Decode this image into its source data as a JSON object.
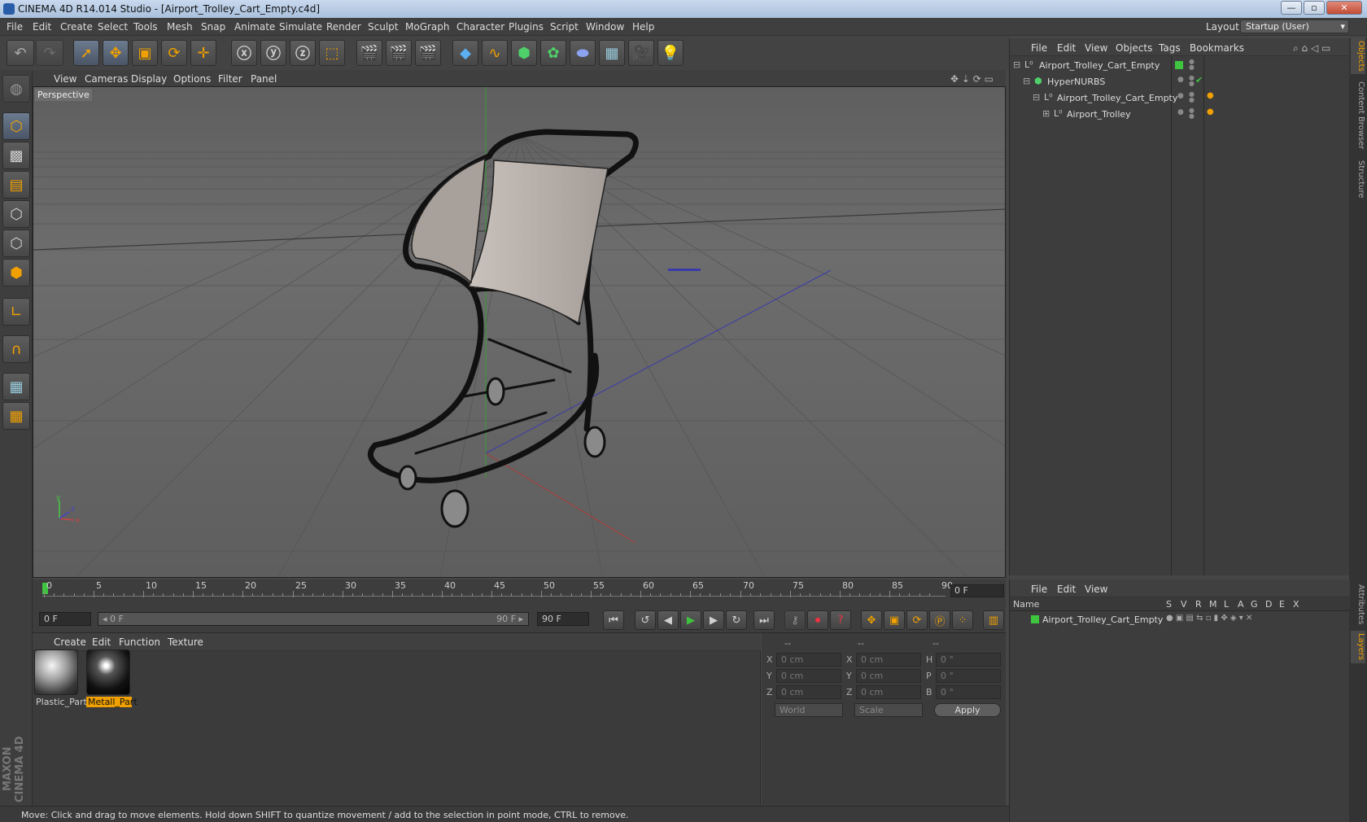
{
  "title_bar": {
    "title": "CINEMA 4D R14.014 Studio - [Airport_Trolley_Cart_Empty.c4d]",
    "min": "—",
    "max": "▫",
    "close": "✕"
  },
  "menu": {
    "items": [
      "File",
      "Edit",
      "Create",
      "Select",
      "Tools",
      "Mesh",
      "Snap",
      "Animate",
      "Simulate",
      "Render",
      "Sculpt",
      "MoGraph",
      "Character",
      "Plugins",
      "Script",
      "Window",
      "Help"
    ],
    "layout_label": "Layout:",
    "layout_value": "Startup (User)"
  },
  "viewport": {
    "menu": [
      "View",
      "Cameras",
      "Display",
      "Options",
      "Filter",
      "Panel"
    ],
    "label": "Perspective",
    "axis": {
      "x": "x",
      "y": "y",
      "z": "z"
    }
  },
  "timeline": {
    "ticks": [
      "0",
      "5",
      "10",
      "15",
      "20",
      "25",
      "30",
      "35",
      "40",
      "45",
      "50",
      "55",
      "60",
      "65",
      "70",
      "75",
      "80",
      "85",
      "90"
    ],
    "current_frame": "0 F"
  },
  "transport": {
    "start": "0 F",
    "range_start": "◂ 0 F",
    "range_end": "90 F ▸",
    "end": "90 F"
  },
  "materials": {
    "menu": [
      "Create",
      "Edit",
      "Function",
      "Texture"
    ],
    "items": [
      {
        "name": "Plastic_Part"
      },
      {
        "name": "Metall_Part"
      }
    ]
  },
  "coordinates": {
    "header": [
      "--",
      "--",
      "--"
    ],
    "rows": [
      {
        "a": "X",
        "av": "0 cm",
        "b": "X",
        "bv": "0 cm",
        "c": "H",
        "cv": "0 °"
      },
      {
        "a": "Y",
        "av": "0 cm",
        "b": "Y",
        "bv": "0 cm",
        "c": "P",
        "cv": "0 °"
      },
      {
        "a": "Z",
        "av": "0 cm",
        "b": "Z",
        "bv": "0 cm",
        "c": "B",
        "cv": "0 °"
      }
    ],
    "space": "World",
    "mode": "Scale",
    "apply": "Apply"
  },
  "objects": {
    "menu": [
      "File",
      "Edit",
      "View",
      "Objects",
      "Tags",
      "Bookmarks"
    ],
    "tree": [
      {
        "name": "Airport_Trolley_Cart_Empty"
      },
      {
        "name": "HyperNURBS"
      },
      {
        "name": "Airport_Trolley_Cart_Empty"
      },
      {
        "name": "Airport_Trolley"
      }
    ]
  },
  "layers": {
    "menu": [
      "File",
      "Edit",
      "View"
    ],
    "columns": [
      "Name",
      "S",
      "V",
      "R",
      "M",
      "L",
      "A",
      "G",
      "D",
      "E",
      "X"
    ],
    "row": "Airport_Trolley_Cart_Empty"
  },
  "side_tabs": [
    "Objects",
    "Content Browser",
    "Structure",
    "Attributes",
    "Layers"
  ],
  "brand": "MAXON CINEMA 4D",
  "status": "Move: Click and drag to move elements. Hold down SHIFT to quantize movement / add to the selection in point mode, CTRL to remove.",
  "colors": {
    "accent": "#f0a000",
    "green": "#3fc43f",
    "viewport_bg": "#666666"
  }
}
